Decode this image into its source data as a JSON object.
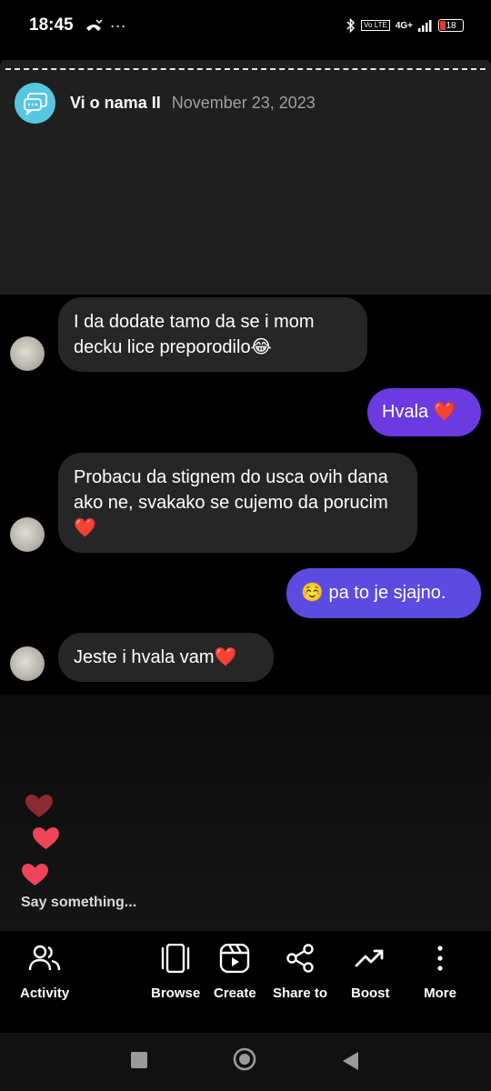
{
  "status_bar": {
    "time": "18:45",
    "left_icons": [
      "missed-call-icon",
      "more-dots-icon"
    ],
    "volte": "Vo LTE",
    "network": "4G+",
    "battery": "18"
  },
  "post": {
    "author": "Vi o nama II",
    "date": "November 23, 2023",
    "avatar_icon": "chat-bubbles-icon",
    "avatar_color": "#57c6e0"
  },
  "messages": [
    {
      "side": "in",
      "text": "I da dodate tamo da se i mom decku lice preporodilo😂"
    },
    {
      "side": "out",
      "text": "Hvala ❤️"
    },
    {
      "side": "in",
      "text": "Probacu da stignem do usca ovih dana ako ne, svakako se cujemo da porucim❤️"
    },
    {
      "side": "out",
      "text": "☺️ pa to je sjajno."
    },
    {
      "side": "in",
      "text": "Jeste i hvala vam❤️"
    }
  ],
  "composer": {
    "placeholder": "Say something..."
  },
  "actions": [
    {
      "label": "Activity",
      "icon": "people-icon"
    },
    {
      "label": "Browse",
      "icon": "carousel-icon"
    },
    {
      "label": "Create",
      "icon": "reels-icon"
    },
    {
      "label": "Share to",
      "icon": "share-icon"
    },
    {
      "label": "Boost",
      "icon": "trend-up-icon"
    },
    {
      "label": "More",
      "icon": "vertical-dots-icon"
    }
  ],
  "colors": {
    "outgoing_bubble": "#6b3ae0",
    "incoming_bubble": "#262626",
    "heart": "#f0445a"
  }
}
